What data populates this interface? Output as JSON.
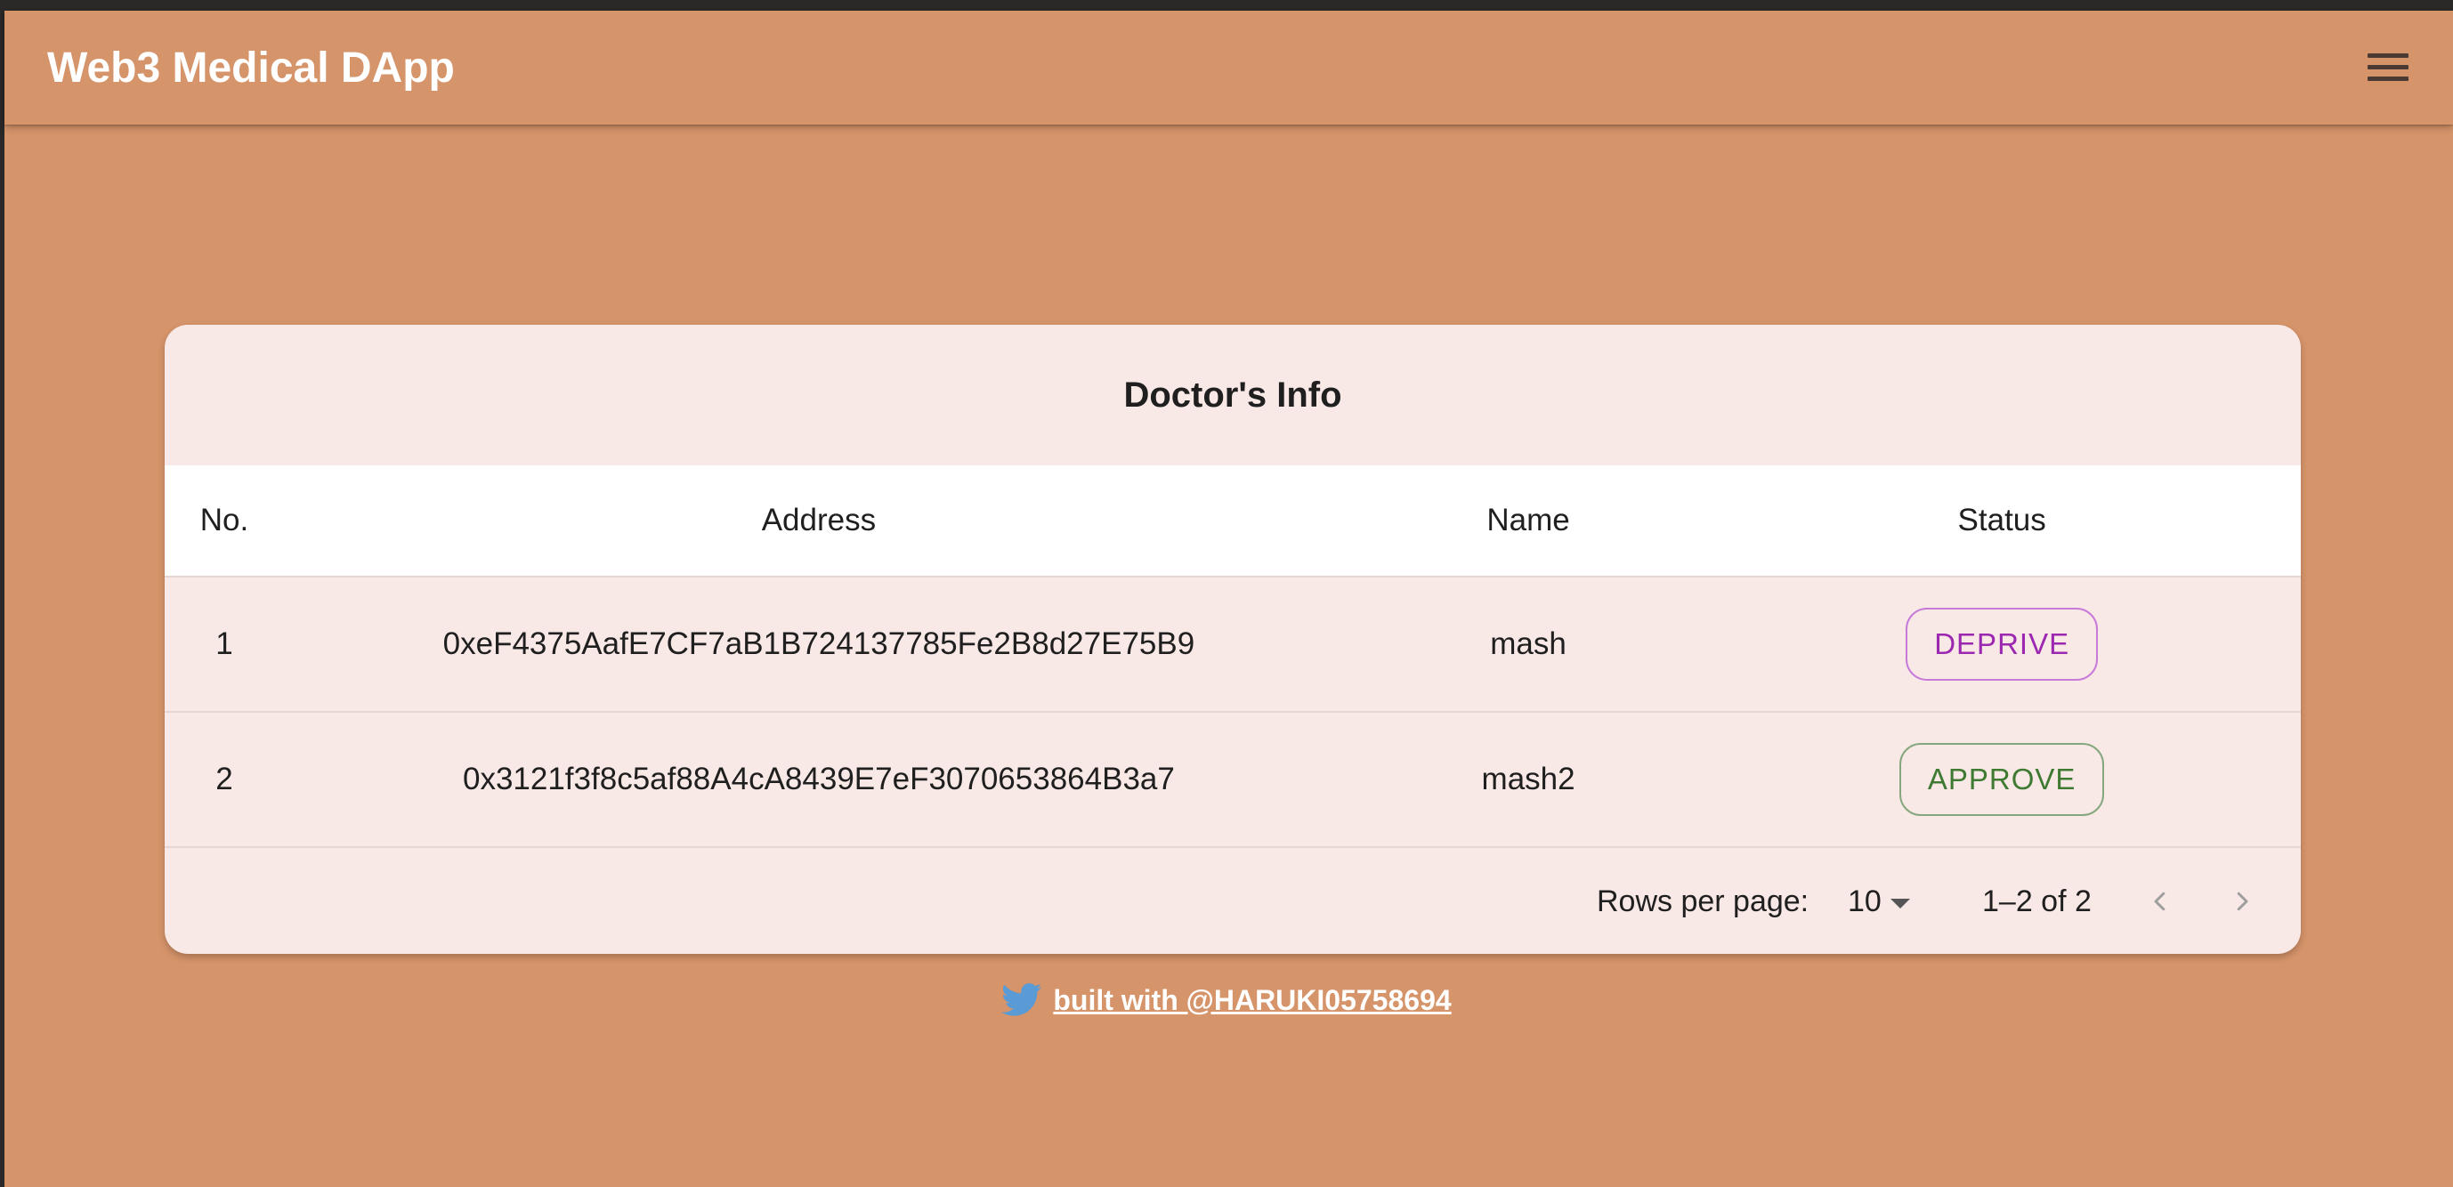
{
  "appbar": {
    "title": "Web3 Medical DApp",
    "menu_icon": "menu-icon"
  },
  "card": {
    "title": "Doctor's Info",
    "columns": {
      "no": "No.",
      "address": "Address",
      "name": "Name",
      "status": "Status"
    },
    "rows": [
      {
        "no": "1",
        "address": "0xeF4375AafE7CF7aB1B724137785Fe2B8d27E75B9",
        "name": "mash",
        "status_action": "DEPRIVE"
      },
      {
        "no": "2",
        "address": "0x3121f3f8c5af88A4cA8439E7eF3070653864B3a7",
        "name": "mash2",
        "status_action": "APPROVE"
      }
    ],
    "pagination": {
      "rows_per_page_label": "Rows per page:",
      "rows_per_page_value": "10",
      "range_label": "1–2 of 2",
      "prev_icon": "chevron-left-icon",
      "next_icon": "chevron-right-icon"
    }
  },
  "footer": {
    "link_text": "built with @HARUKI05758694",
    "icon": "twitter-icon"
  },
  "colors": {
    "background": "#d6946a",
    "card": "#f8e8e6",
    "deprive": "#9c27b0",
    "approve": "#3f7a32",
    "twitter": "#5b9bd5"
  }
}
